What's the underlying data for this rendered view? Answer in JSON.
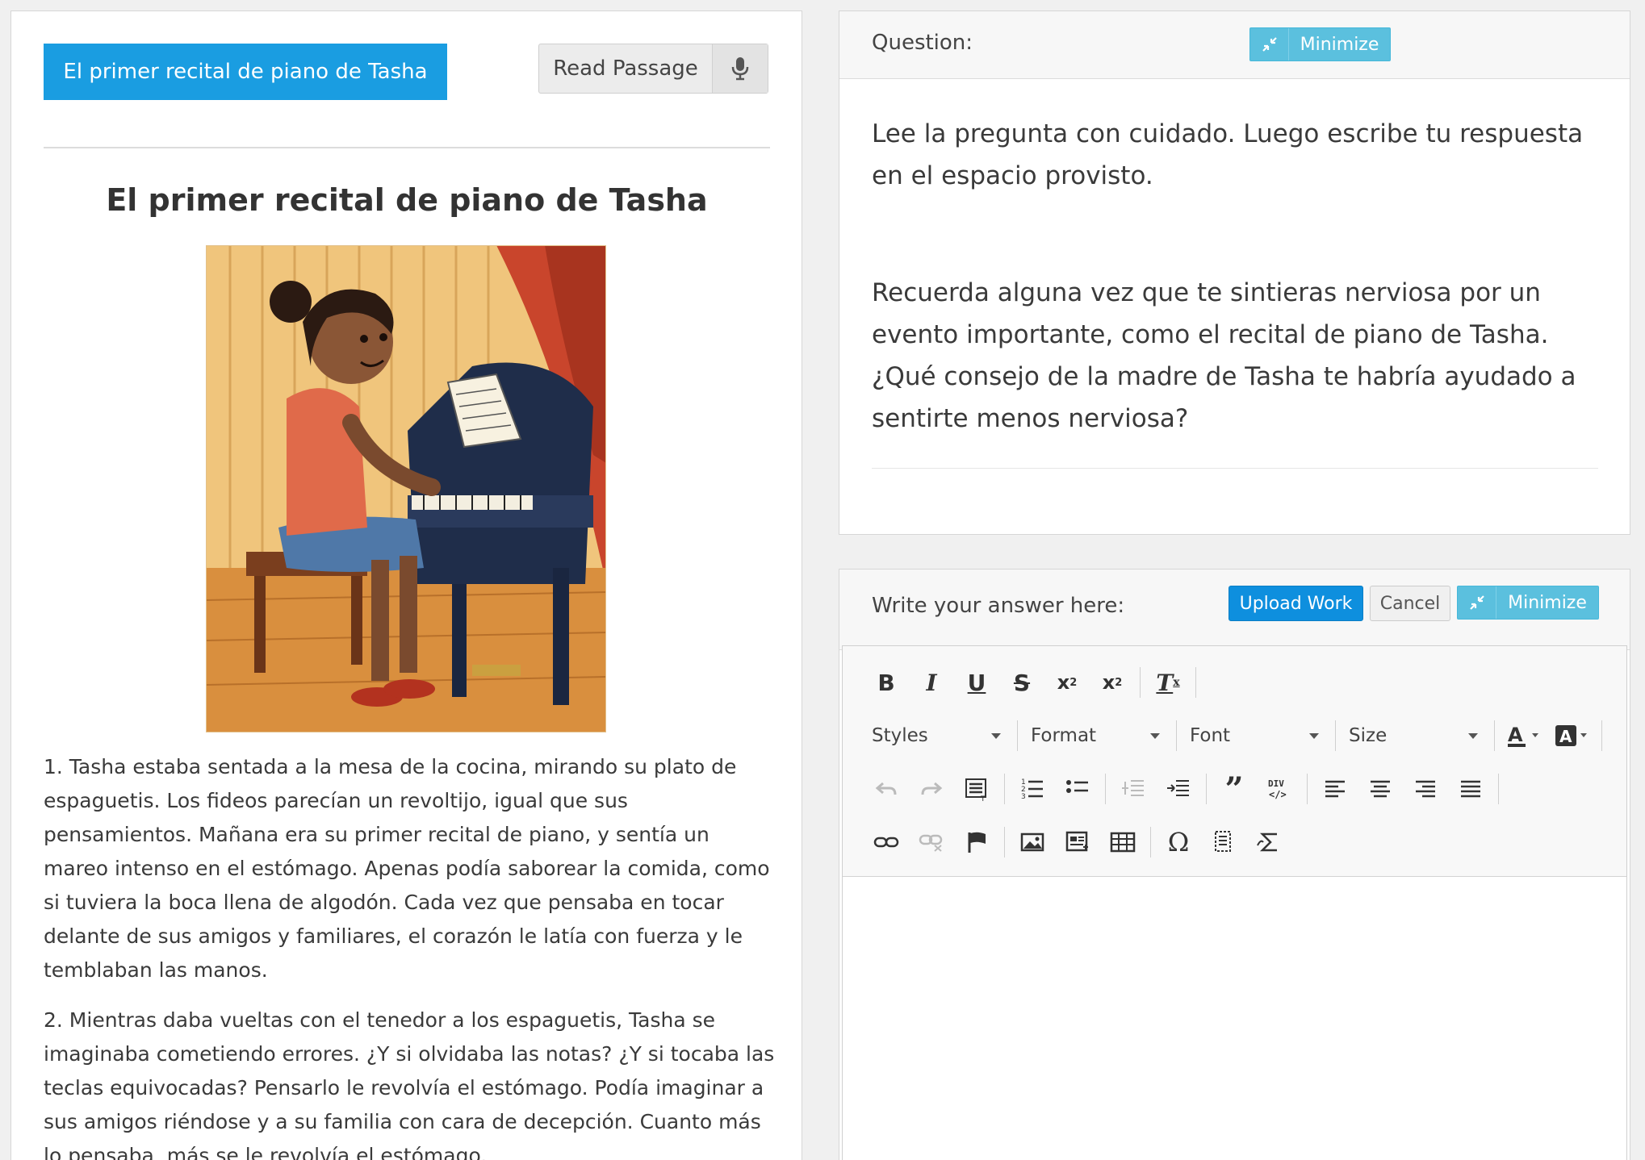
{
  "passage": {
    "tab_label": "El primer recital de piano de Tasha",
    "read_passage_label": "Read Passage",
    "title": "El primer recital de piano de Tasha",
    "paragraphs": [
      "1. Tasha estaba sentada a la mesa de la cocina, mirando su plato de espaguetis. Los fideos parecían un revoltijo, igual que sus pensamientos. Mañana era su primer recital de piano, y sentía un mareo intenso en el estómago. Apenas podía saborear la comida, como si tuviera la boca llena de algodón. Cada vez que pensaba en tocar delante de sus amigos y familiares, el corazón le latía con fuerza y le temblaban las manos.",
      "2. Mientras daba vueltas con el tenedor a los espaguetis, Tasha se imaginaba cometiendo errores. ¿Y si olvidaba las notas? ¿Y si tocaba las teclas equivocadas? Pensarlo le revolvía el estómago. Podía imaginar a sus amigos riéndose y a su familia con cara de decepción. Cuanto más lo pensaba, más se le revolvía el estómago."
    ]
  },
  "question": {
    "header_label": "Question:",
    "minimize_label": "Minimize",
    "instruction": "Lee la pregunta con cuidado. Luego escribe tu respuesta en el espacio provisto.",
    "prompt": "Recuerda alguna vez que te sintieras nerviosa por un evento importante, como el recital de piano de Tasha. ¿Qué consejo de la madre de Tasha te habría ayudado a sentirte menos nerviosa?"
  },
  "answer": {
    "header_label": "Write your answer here:",
    "upload_label": "Upload Work",
    "cancel_label": "Cancel",
    "minimize_label": "Minimize",
    "combos": {
      "styles": "Styles",
      "format": "Format",
      "font": "Font",
      "size": "Size"
    }
  },
  "colors": {
    "primary": "#1a9de1",
    "info": "#5bc0de",
    "upload": "#0e8fde"
  }
}
